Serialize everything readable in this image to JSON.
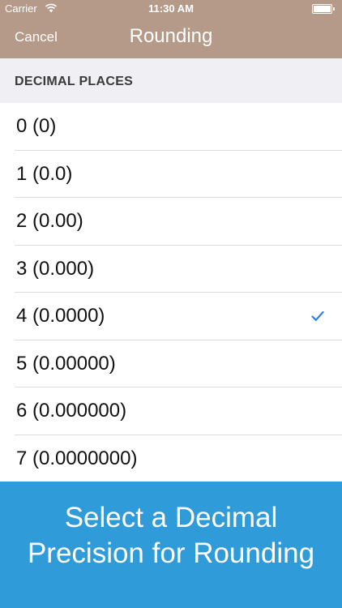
{
  "status_bar": {
    "carrier": "Carrier",
    "time": "11:30 AM"
  },
  "nav": {
    "cancel_label": "Cancel",
    "title": "Rounding"
  },
  "section": {
    "header": "DECIMAL PLACES"
  },
  "options": [
    {
      "label": "0 (0)",
      "selected": false
    },
    {
      "label": "1 (0.0)",
      "selected": false
    },
    {
      "label": "2 (0.00)",
      "selected": false
    },
    {
      "label": "3 (0.000)",
      "selected": false
    },
    {
      "label": "4 (0.0000)",
      "selected": true
    },
    {
      "label": "5 (0.00000)",
      "selected": false
    },
    {
      "label": "6 (0.000000)",
      "selected": false
    },
    {
      "label": "7 (0.0000000)",
      "selected": false
    }
  ],
  "banner": {
    "line1": "Select a Decimal",
    "line2": "Precision for Rounding"
  },
  "colors": {
    "nav_bg": "#b59a8a",
    "accent": "#2f80ed",
    "banner_bg": "#2f9bd8"
  },
  "icons": {
    "wifi": "wifi-icon",
    "battery": "battery-icon",
    "check": "checkmark-icon"
  }
}
